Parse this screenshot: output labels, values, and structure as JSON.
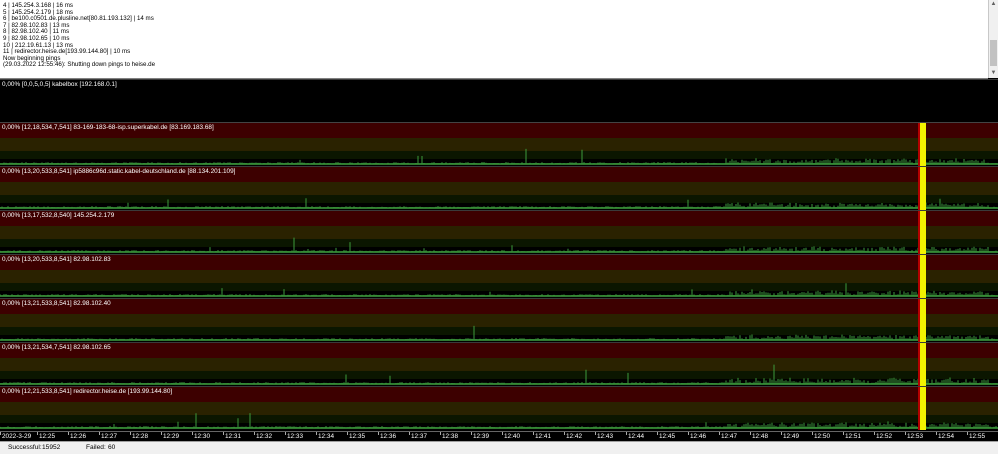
{
  "colors": {
    "background": "#000000",
    "zone_high": "#3d0000",
    "zone_mid": "#2a2200",
    "zone_low": "#0b1600",
    "latency_trace": "#3c9a3c",
    "spike_marker": "#f2f200",
    "spike_marker_edge": "#b40000",
    "label_text": "#ffffff"
  },
  "log": {
    "lines": [
      "4 | 145.254.3.168 | 16 ms",
      "5 | 145.254.2.179 | 18 ms",
      "6 | be100.c0501.de.plusline.net[80.81.193.132] | 14 ms",
      "7 | 82.98.102.83 | 13 ms",
      "8 | 82.98.102.40 | 11 ms",
      "9 | 82.98.102.65 | 10 ms",
      "10 | 212.19.61.13 | 13 ms",
      "11 | redirector.heise.de[193.99.144.80] | 10 ms",
      "Now beginning pings",
      "(29.03.2022 12:55:46): Shutting down pings to heise.de"
    ]
  },
  "scrollbar": {
    "up_icon": "▲",
    "down_icon": "▼"
  },
  "hops": [
    {
      "label": "0,00% [0,0,5,0,5] kabelbox [192.168.0.1]",
      "activity": 0.15,
      "spike": false
    },
    {
      "label": "0,00% [12,18,534,7,541] 83-169-183-68-isp.superkabel.de [83.169.183.68]",
      "activity": 1,
      "spike": true
    },
    {
      "label": "0,00% [13,20,533,8,541] ip5886c96d.static.kabel-deutschland.de [88.134.201.109]",
      "activity": 1,
      "spike": true
    },
    {
      "label": "0,00% [13,17,532,8,540] 145.254.2.179",
      "activity": 1,
      "spike": true
    },
    {
      "label": "0,00% [13,20,533,8,541] 82.98.102.83",
      "activity": 1,
      "spike": true
    },
    {
      "label": "0,00% [13,21,533,8,541] 82.98.102.40",
      "activity": 1,
      "spike": true
    },
    {
      "label": "0,00% [13,21,534,7,541] 82.98.102.65",
      "activity": 1.2,
      "spike": true
    },
    {
      "label": "0,00% [12,21,533,8,541] redirector.heise.de [193.99.144.80]",
      "activity": 1,
      "spike": true
    }
  ],
  "axis": {
    "ticks": [
      "2022-3-29",
      "12:25",
      "12:26",
      "12:27",
      "12:28",
      "12:29",
      "12:30",
      "12:31",
      "12:32",
      "12:33",
      "12:34",
      "12:35",
      "12:36",
      "12:37",
      "12:38",
      "12:39",
      "12:40",
      "12:41",
      "12:42",
      "12:43",
      "12:44",
      "12:45",
      "12:46",
      "12:47",
      "12:48",
      "12:49",
      "12:50",
      "12:51",
      "12:52",
      "12:53",
      "12:54",
      "12:55"
    ]
  },
  "status": {
    "successful_label": "Successful:",
    "successful_value": "15952",
    "failed_label": "Failed:",
    "failed_value": "60"
  }
}
